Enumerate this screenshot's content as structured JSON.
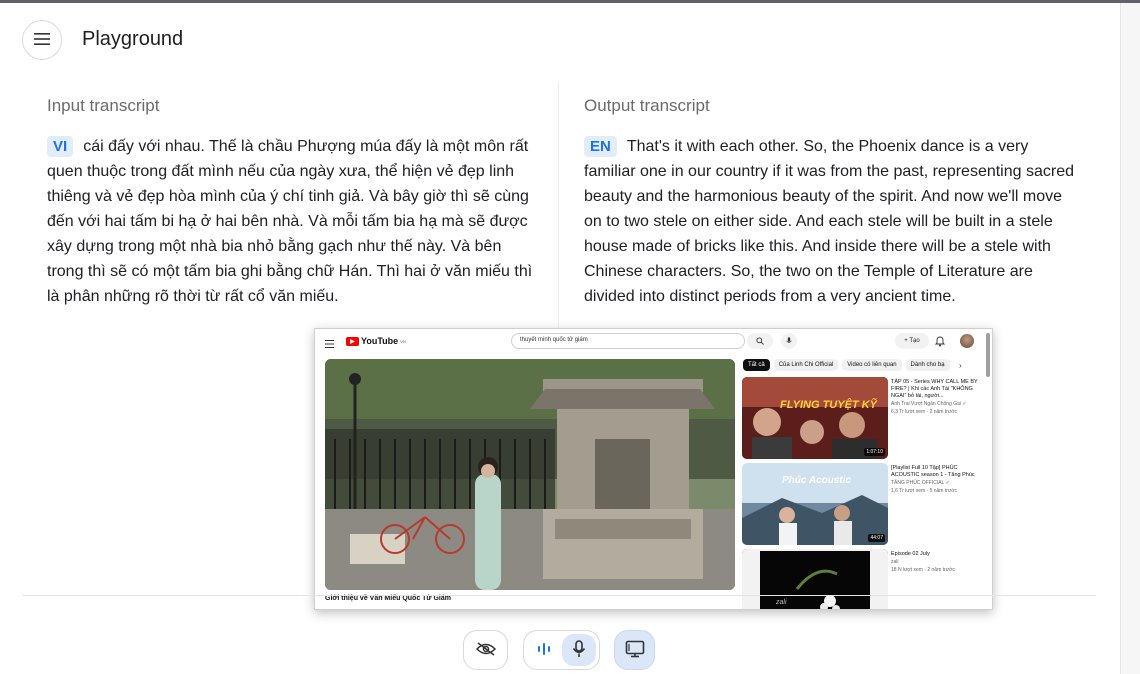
{
  "app": {
    "title": "Playground"
  },
  "input": {
    "heading": "Input transcript",
    "lang": "VI",
    "text": "cái đấy với nhau. Thế là chầu Phượng múa đấy là một môn rất quen thuộc trong đất mình nếu của ngày xưa, thể hiện vẻ đẹp linh thiêng và vẻ đẹp hòa mình của ý chí tinh giả. Và bây giờ thì sẽ cùng đến với hai tấm bi hạ ở hai bên nhà. Và mỗi tấm bia hạ mà sẽ được xây dựng trong một nhà bia nhỏ bằng gạch như thế này. Và bên trong thì sẽ có một tấm bia ghi bằng chữ Hán. Thì hai ở văn miếu thì là phân những rõ thời từ rất cổ văn miếu."
  },
  "output": {
    "heading": "Output transcript",
    "lang": "EN",
    "text": "That's it with each other. So, the Phoenix dance is a very familiar one in our country if it was from the past, representing sacred beauty and the harmonious beauty of the spirit. And now we'll move on to two stele on either side. And each stele will be built in a stele house made of bricks like this. And inside there will be a stele with Chinese characters. So, the two on the Temple of Literature are divided into distinct periods from a very ancient time."
  },
  "controls": {
    "visibility_icon": "eye-off-icon",
    "audio_icon": "audio-wave-icon",
    "mic_icon": "mic-icon",
    "screen_icon": "screen-share-icon",
    "accent": "#dbe6f8"
  },
  "shared_screen": {
    "logo": "YouTube",
    "logo_sup": "VN",
    "search_query": "thuyết minh quốc tử giám",
    "create_label": "+ Tạo",
    "video_title": "Giới thiệu về Văn Miếu Quốc Tử Giám",
    "chips": [
      "Tất cả",
      "Của Linh Chi Official",
      "Video có liên quan",
      "Dành cho bạ"
    ],
    "recommendations": [
      {
        "title": "TẬP 05 - Series WHY CALL ME BY FIRE? | Khi các Anh Tài \"KHÔNG NGẠI\" bỏ tài, người...",
        "channel": "Anh Trai Vượt Ngàn Chông Gai ✓",
        "stats": "6,3 Tr lượt xem · 2 năm trước",
        "duration": "1:07:10",
        "thumb_text": "FLYING TUYỆT KỸ"
      },
      {
        "title": "[Playlist Full 10 Tập] PHÚC ACOUSTIC season 1 - Tăng Phúc",
        "channel": "TĂNG PHÚC OFFICIAL ✓",
        "stats": "1,6 Tr lượt xem · 5 năm trước",
        "duration": "44:07",
        "thumb_text": "Phúc Acoustic"
      },
      {
        "title": "Episode 02 July",
        "channel": "zali",
        "stats": "18 N lượt xem · 2 năm trước",
        "duration": "",
        "thumb_text": "zali"
      }
    ]
  }
}
